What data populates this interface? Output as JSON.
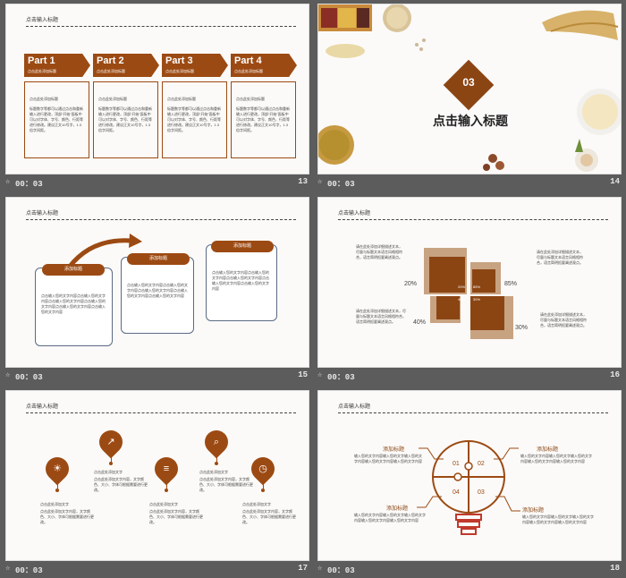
{
  "slides": [
    {
      "number": "13",
      "time": "00：03",
      "header": "点击输入标题",
      "parts": [
        {
          "title": "Part 1",
          "sub": "点击此处添加标题",
          "head": "点击此处添加标题",
          "body": "标题数字等都可以通过点击和重新输入进行更改，顶部“开始”面板中可以对字体、字号、颜色、行距等进行修改。建议正文10号字，1.3倍字间距。"
        },
        {
          "title": "Part 2",
          "sub": "点击此处添加标题",
          "head": "点击此处添加标题",
          "body": "标题数字等都可以通过点击和重新输入进行更改，顶部“开始”面板中可以对字体、字号、颜色、行距等进行修改。建议正文10号字，1.3倍字间距。"
        },
        {
          "title": "Part 3",
          "sub": "点击此处添加标题",
          "head": "点击此处添加标题",
          "body": "标题数字等都可以通过点击和重新输入进行更改，顶部“开始”面板中可以对字体、字号、颜色、行距等进行修改。建议正文10号字，1.3倍字间距。"
        },
        {
          "title": "Part 4",
          "sub": "点击此处添加标题",
          "head": "点击此处添加标题",
          "body": "标题数字等都可以通过点击和重新输入进行更改，顶部“开始”面板中可以对字体、字号、颜色、行距等进行修改。建议正文10号字，1.3倍字间距。"
        }
      ]
    },
    {
      "number": "14",
      "time": "00：03",
      "section": "03",
      "title": "点击输入标题"
    },
    {
      "number": "15",
      "time": "00：03",
      "header": "点击输入标题",
      "cards": [
        {
          "label": "添加标题",
          "body": "点击输入您的文字内容点击输入您的文字内容点击输入您的文字内容点击输入您的文字内容点击输入您的文字内容点击输入您的文字内容"
        },
        {
          "label": "添加标题",
          "body": "点击输入您的文字内容点击输入您的文字内容点击输入您的文字内容点击输入您的文字内容点击输入您的文字内容"
        },
        {
          "label": "添加标题",
          "body": "点击输入您的文字内容点击输入您的文字内容点击输入您的文字内容点击输入您的文字内容点击输入您的文字内容"
        }
      ]
    },
    {
      "number": "16",
      "time": "00：03",
      "header": "点击输入标题",
      "percents": [
        "20%",
        "85%",
        "40%",
        "30%"
      ],
      "inner": [
        "20%",
        "85%",
        "40%",
        "30%"
      ],
      "notes": [
        "请在此处添加详细描述文本，尽量与标题文本语言风格相符合，语言简明扼要阐述观点。",
        "请在此处添加详细描述文本，尽量与标题文本语言风格相符合，语言简明扼要阐述观点。",
        "请在此处添加详细描述文本，尽量与标题文本语言风格相符合，语言简明扼要阐述观点。",
        "请在此处添加详细描述文本，尽量与标题文本语言风格相符合，语言简明扼要阐述观点。"
      ]
    },
    {
      "number": "17",
      "time": "00：03",
      "header": "点击输入标题",
      "items": [
        {
          "icon": "lightbulb-icon",
          "glyph": "☀",
          "head": "点击此处添加文字",
          "body": "点击此处添加文字内容，文字颜色、大小、字体可根据需要进行更改。"
        },
        {
          "icon": "chart-icon",
          "glyph": "↗",
          "head": "点击此处添加文字",
          "body": "点击此处添加文字内容，文字颜色、大小、字体可根据需要进行更改。"
        },
        {
          "icon": "document-icon",
          "glyph": "≡",
          "head": "点击此处添加文字",
          "body": "点击此处添加文字内容，文字颜色、大小、字体可根据需要进行更改。"
        },
        {
          "icon": "magnifier-icon",
          "glyph": "⌕",
          "head": "点击此处添加文字",
          "body": "点击此处添加文字内容，文字颜色、大小、字体可根据需要进行更改。"
        },
        {
          "icon": "stopwatch-icon",
          "glyph": "◷",
          "head": "点击此处添加文字",
          "body": "点击此处添加文字内容，文字颜色、大小、字体可根据需要进行更改。"
        }
      ]
    },
    {
      "number": "18",
      "time": "00：03",
      "header": "点击输入标题",
      "pieces": [
        "01",
        "02",
        "04",
        "03"
      ],
      "labels": [
        {
          "title": "添加标题",
          "body": "输入您的文字内容输入您的文字输入您的文字内容输入您的文字内容输入您的文字内容"
        },
        {
          "title": "添加标题",
          "body": "输入您的文字内容输入您的文字输入您的文字内容输入您的文字内容输入您的文字内容"
        },
        {
          "title": "添加标题",
          "body": "输入您的文字内容输入您的文字输入您的文字内容输入您的文字内容输入您的文字内容"
        },
        {
          "title": "添加标题",
          "body": "输入您的文字内容输入您的文字输入您的文字内容输入您的文字内容输入您的文字内容"
        }
      ]
    }
  ],
  "colors": {
    "accent": "#9c4a13",
    "background": "#5c5c5c",
    "light": "#c8a382"
  }
}
